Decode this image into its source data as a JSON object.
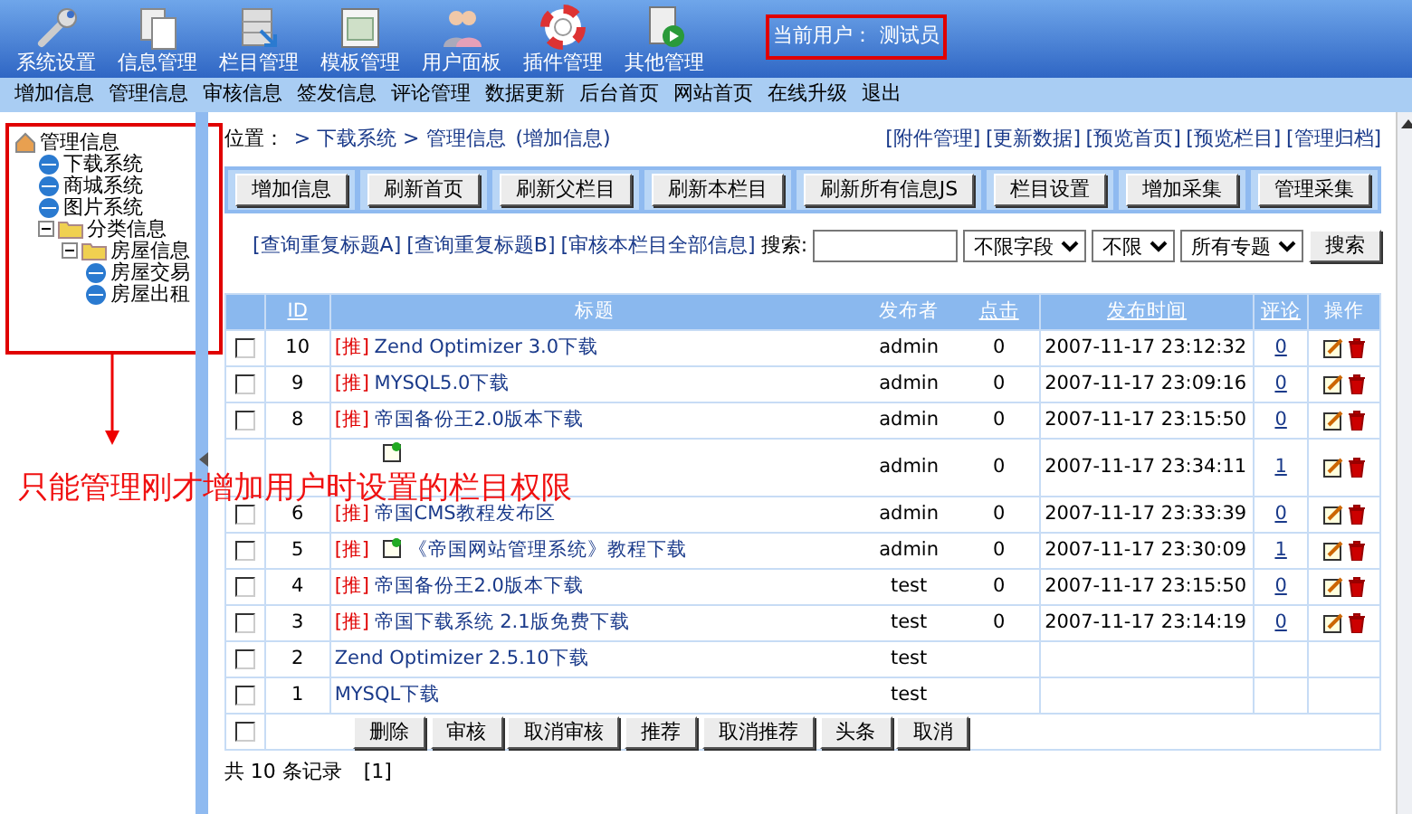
{
  "toolbar": {
    "items": [
      {
        "label": "系统设置"
      },
      {
        "label": "信息管理"
      },
      {
        "label": "栏目管理"
      },
      {
        "label": "模板管理"
      },
      {
        "label": "用户面板"
      },
      {
        "label": "插件管理"
      },
      {
        "label": "其他管理"
      }
    ],
    "current_user": {
      "label": "当前用户：",
      "name": "测试员"
    }
  },
  "menu": [
    "增加信息",
    "管理信息",
    "审核信息",
    "签发信息",
    "评论管理",
    "数据更新",
    "后台首页",
    "网站首页",
    "在线升级",
    "退出"
  ],
  "tree": {
    "label": "管理信息",
    "children": [
      {
        "label": "下载系统"
      },
      {
        "label": "商城系统"
      },
      {
        "label": "图片系统"
      },
      {
        "label": "分类信息",
        "expanded": true,
        "children": [
          {
            "label": "房屋信息",
            "expanded": true,
            "children": [
              {
                "label": "房屋交易"
              },
              {
                "label": "房屋出租"
              }
            ]
          }
        ]
      }
    ]
  },
  "annotation": "只能管理刚才增加用户时设置的栏目权限",
  "breadcrumb": {
    "label": "位置：",
    "path": "> 下载系统 > 管理信息",
    "note": "(增加信息)"
  },
  "links": [
    "[附件管理]",
    "[更新数据]",
    "[预览首页]",
    "[预览栏目]",
    "[管理归档]"
  ],
  "buttons": [
    "增加信息",
    "刷新首页",
    "刷新父栏目",
    "刷新本栏目",
    "刷新所有信息JS",
    "栏目设置",
    "增加采集",
    "管理采集"
  ],
  "search_links": [
    "[查询重复标题A]",
    "[查询重复标题B]",
    "[审核本栏目全部信息]"
  ],
  "search": {
    "label": "搜索:",
    "selects": [
      "不限字段",
      "不限",
      "所有专题"
    ],
    "button": "搜索"
  },
  "table": {
    "columns": [
      {
        "label": "ID",
        "sortable": true
      },
      {
        "label": "标题",
        "sortable": false
      },
      {
        "label": "发布者",
        "sortable": false
      },
      {
        "label": "点击",
        "sortable": true
      },
      {
        "label": "发布时间",
        "sortable": true
      },
      {
        "label": "评论",
        "sortable": true
      },
      {
        "label": "操作",
        "sortable": false
      }
    ],
    "rows": [
      {
        "checked": false,
        "id": "10",
        "tag": "[推]",
        "image_icon": false,
        "title": "Zend Optimizer 3.0下载",
        "author": "admin",
        "clicks": "0",
        "time": "2007-11-17 23:12:32",
        "comments": "0",
        "ops": true
      },
      {
        "checked": false,
        "id": "9",
        "tag": "[推]",
        "image_icon": false,
        "title": "MYSQL5.0下载",
        "author": "admin",
        "clicks": "0",
        "time": "2007-11-17 23:09:16",
        "comments": "0",
        "ops": true
      },
      {
        "checked": false,
        "id": "8",
        "tag": "[推]",
        "image_icon": false,
        "title": "帝国备份王2.0版本下载",
        "author": "admin",
        "clicks": "0",
        "time": "2007-11-17 23:15:50",
        "comments": "0",
        "ops": true
      },
      {
        "image_icon": true,
        "author": "admin",
        "clicks": "0",
        "time": "2007-11-17 23:34:11",
        "comments": "1",
        "ops": true
      },
      {
        "checked": false,
        "id": "6",
        "tag": "[推]",
        "image_icon": false,
        "title": "帝国CMS教程发布区",
        "author": "admin",
        "clicks": "0",
        "time": "2007-11-17 23:33:39",
        "comments": "0",
        "ops": true
      },
      {
        "checked": false,
        "id": "5",
        "tag": "[推]",
        "image_icon": true,
        "title": "《帝国网站管理系统》教程下载",
        "author": "admin",
        "clicks": "0",
        "time": "2007-11-17 23:30:09",
        "comments": "1",
        "ops": true
      },
      {
        "checked": false,
        "id": "4",
        "tag": "[推]",
        "image_icon": false,
        "title": "帝国备份王2.0版本下载",
        "author": "test",
        "clicks": "0",
        "time": "2007-11-17 23:15:50",
        "comments": "0",
        "ops": true
      },
      {
        "checked": false,
        "id": "3",
        "tag": "[推]",
        "image_icon": false,
        "title": "帝国下载系统 2.1版免费下载",
        "author": "test",
        "clicks": "0",
        "time": "2007-11-17 23:14:19",
        "comments": "0",
        "ops": true
      },
      {
        "checked": false,
        "id": "2",
        "image_icon": false,
        "title": "Zend Optimizer 2.5.10下载",
        "author": "test",
        "ops": false
      },
      {
        "checked": false,
        "id": "1",
        "image_icon": false,
        "title": "MYSQL下载",
        "author": "test",
        "ops": false
      }
    ]
  },
  "select_all": {
    "checked": false
  },
  "actions": [
    "删除",
    "审核",
    "取消审核",
    "推荐",
    "取消推荐",
    "头条",
    "取消"
  ],
  "footer": {
    "count": "共 10 条记录",
    "pages": "[1]"
  }
}
